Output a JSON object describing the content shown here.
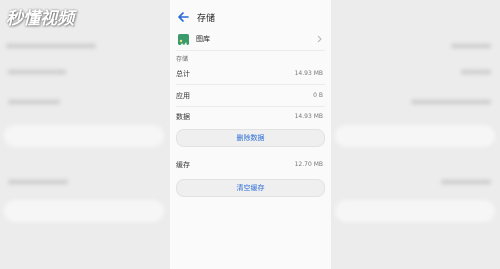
{
  "watermark": "秒懂视频",
  "header": {
    "title": "存储"
  },
  "app": {
    "name": "图库"
  },
  "section": {
    "label": "存储"
  },
  "storage": {
    "total": {
      "label": "总计",
      "value": "14.93 MB"
    },
    "app": {
      "label": "应用",
      "value": "0 B"
    },
    "data": {
      "label": "数据",
      "value": "14.93 MB"
    }
  },
  "clear_data_button": "删除数据",
  "cache": {
    "label": "缓存",
    "value": "12.70 MB"
  },
  "clear_cache_button": "清空缓存",
  "icons": [
    "back-arrow-icon",
    "gallery-icon",
    "chevron-right-icon"
  ],
  "colors": {
    "accent": "#2a6bd6",
    "gallery_icon": "#3a9a6b"
  }
}
